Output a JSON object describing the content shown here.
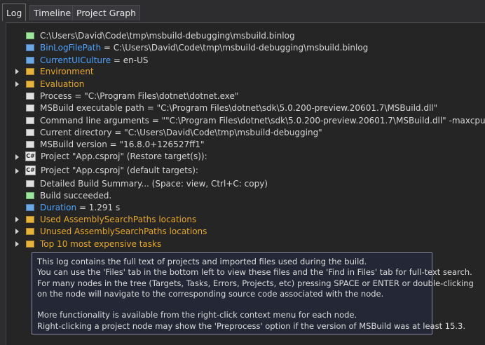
{
  "tabs": [
    {
      "label": "Log"
    },
    {
      "label": "Timeline"
    },
    {
      "label": "Project Graph"
    }
  ],
  "colors": {
    "green": "#9be79b",
    "blue": "#6aa8e8",
    "orange": "#e8b339",
    "gray": "#e0e0e0"
  },
  "tree": [
    {
      "text": "C:\\Users\\David\\Code\\tmp\\msbuild-debugging\\msbuild.binlog",
      "box": "green",
      "arrow": false
    },
    {
      "name": "BinLogFilePath",
      "value": " = C:\\Users\\David\\Code\\tmp\\msbuild-debugging\\msbuild.binlog",
      "box": "blue",
      "arrow": false
    },
    {
      "name": "CurrentUICulture",
      "value": " = en-US",
      "box": "blue",
      "arrow": false
    },
    {
      "text": "Environment",
      "box": "orange",
      "arrow": true,
      "style": "orange"
    },
    {
      "text": "Evaluation",
      "box": "orange",
      "arrow": true,
      "style": "orange"
    },
    {
      "text": "Process = \"C:\\Program Files\\dotnet\\dotnet.exe\"",
      "box": "gray",
      "arrow": false
    },
    {
      "text": "MSBuild executable path = \"C:\\Program Files\\dotnet\\sdk\\5.0.200-preview.20601.7\\MSBuild.dll\"",
      "box": "gray",
      "arrow": false
    },
    {
      "text": "Command line arguments = \"\"C:\\Program Files\\dotnet\\sdk\\5.0.200-preview.20601.7\\MSBuild.dll\" -maxcpucount -verbos",
      "box": "gray",
      "arrow": false
    },
    {
      "text": "Current directory = \"C:\\Users\\David\\Code\\tmp\\msbuild-debugging\"",
      "box": "gray",
      "arrow": false
    },
    {
      "text": "MSBuild version = \"16.8.0+126527ff1\"",
      "box": "gray",
      "arrow": false
    },
    {
      "text": "Project \"App.csproj\" (Restore target(s)):",
      "box": "project",
      "arrow": true
    },
    {
      "text": "Project \"App.csproj\" (default targets):",
      "box": "project",
      "arrow": true
    },
    {
      "text": "Detailed Build Summary... (Space: view, Ctrl+C: copy)",
      "box": "gray",
      "arrow": false
    },
    {
      "text": "Build succeeded.",
      "box": "green",
      "arrow": false
    },
    {
      "name": "Duration",
      "value": " = 1.291 s",
      "box": "blue",
      "arrow": false
    },
    {
      "text": "Used AssemblySearchPaths locations",
      "box": "orange",
      "arrow": true,
      "style": "orange"
    },
    {
      "text": "Unused AssemblySearchPaths locations",
      "box": "orange",
      "arrow": true,
      "style": "orange"
    },
    {
      "text": "Top 10 most expensive tasks",
      "box": "orange",
      "arrow": true,
      "style": "orange"
    }
  ],
  "project_icon_label": "C#",
  "help": [
    "This log contains the full text of projects and imported files used during the build.",
    "You can use the 'Files' tab in the bottom left to view these files and the 'Find in Files' tab for full-text search.",
    "For many nodes in the tree (Targets, Tasks, Errors, Projects, etc) pressing SPACE or ENTER or double-clicking",
    "on the node will navigate to the corresponding source code associated with the node.",
    "",
    "More functionality is available from the right-click context menu for each node.",
    "Right-clicking a project node may show the 'Preprocess' option if the version of MSBuild was at least 15.3."
  ]
}
